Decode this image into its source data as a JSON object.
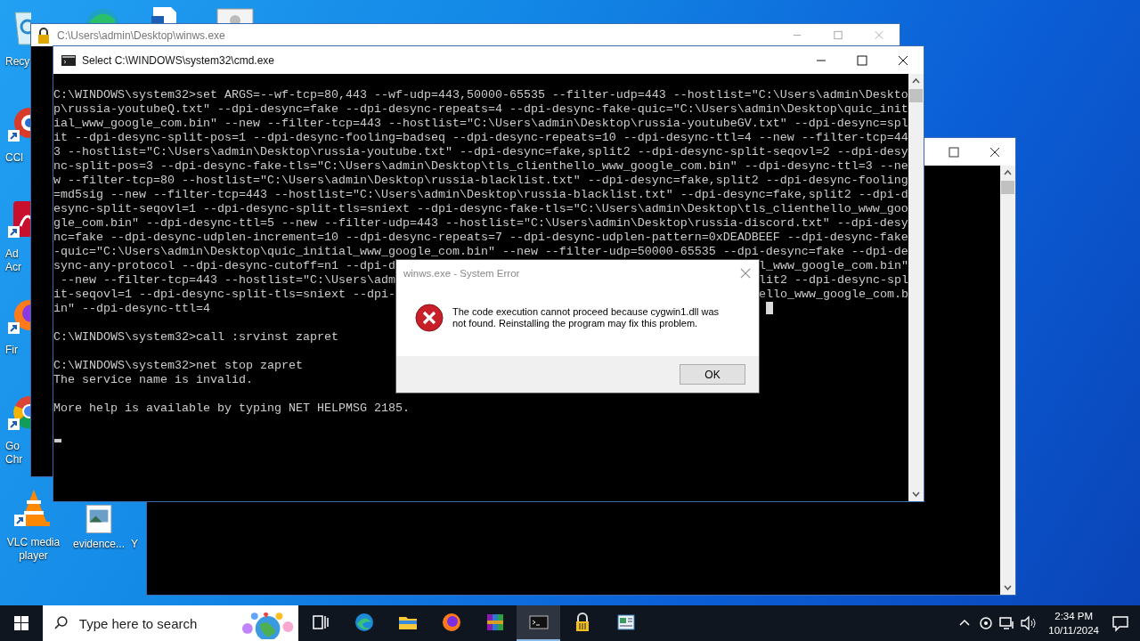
{
  "desktop_icons": [
    {
      "kind": "recycle-bin",
      "lines": [
        "Recy"
      ],
      "shortcut": false
    },
    {
      "kind": "ccleaner",
      "lines": [
        "CCl"
      ],
      "shortcut": true
    },
    {
      "kind": "acrobat",
      "lines": [
        "Ad",
        "Acr"
      ],
      "shortcut": true
    },
    {
      "kind": "firefox",
      "lines": [
        "Fir"
      ],
      "shortcut": true
    },
    {
      "kind": "chrome",
      "lines": [
        "Go",
        "Chr"
      ],
      "shortcut": true
    },
    {
      "kind": "vlc",
      "lines": [
        "VLC media",
        "player"
      ],
      "shortcut": true
    }
  ],
  "desktop_icons_2": [
    {
      "kind": "image",
      "lines": [
        "evidence..."
      ]
    },
    {
      "kind": "none",
      "lines": [
        "Y"
      ]
    }
  ],
  "winws_window": {
    "title": "C:\\Users\\admin\\Desktop\\winws.exe"
  },
  "cmd_window": {
    "title": "Select C:\\WINDOWS\\system32\\cmd.exe",
    "lines": [
      {
        "kind": "line",
        "text": "C:\\WINDOWS\\system32>set ARGS=--wf-tcp=80,443 --wf-udp=443,50000-65535 --filter-udp=443 --hostlist=\"C:\\Users\\admin\\Deskto"
      },
      {
        "kind": "line",
        "text": "p\\russia-youtubeQ.txt\" --dpi-desync=fake --dpi-desync-repeats=4 --dpi-desync-fake-quic=\"C:\\Users\\admin\\Desktop\\quic_init"
      },
      {
        "kind": "line",
        "text": "ial_www_google_com.bin\" --new --filter-tcp=443 --hostlist=\"C:\\Users\\admin\\Desktop\\russia-youtubeGV.txt\" --dpi-desync=spl"
      },
      {
        "kind": "line",
        "text": "it --dpi-desync-split-pos=1 --dpi-desync-fooling=badseq --dpi-desync-repeats=10 --dpi-desync-ttl=4 --new --filter-tcp=44"
      },
      {
        "kind": "line",
        "text": "3 --hostlist=\"C:\\Users\\admin\\Desktop\\russia-youtube.txt\" --dpi-desync=fake,split2 --dpi-desync-split-seqovl=2 --dpi-desy"
      },
      {
        "kind": "line",
        "text": "nc-split-pos=3 --dpi-desync-fake-tls=\"C:\\Users\\admin\\Desktop\\tls_clienthello_www_google_com.bin\" --dpi-desync-ttl=3 --ne"
      },
      {
        "kind": "line",
        "text": "w --filter-tcp=80 --hostlist=\"C:\\Users\\admin\\Desktop\\russia-blacklist.txt\" --dpi-desync=fake,split2 --dpi-desync-fooling"
      },
      {
        "kind": "line",
        "text": "=md5sig --new --filter-tcp=443 --hostlist=\"C:\\Users\\admin\\Desktop\\russia-blacklist.txt\" --dpi-desync=fake,split2 --dpi-d"
      },
      {
        "kind": "line",
        "text": "esync-split-seqovl=1 --dpi-desync-split-tls=sniext --dpi-desync-fake-tls=\"C:\\Users\\admin\\Desktop\\tls_clienthello_www_goo"
      },
      {
        "kind": "line",
        "text": "gle_com.bin\" --dpi-desync-ttl=5 --new --filter-udp=443 --hostlist=\"C:\\Users\\admin\\Desktop\\russia-discord.txt\" --dpi-desy"
      },
      {
        "kind": "line",
        "text": "nc=fake --dpi-desync-udplen-increment=10 --dpi-desync-repeats=7 --dpi-desync-udplen-pattern=0xDEADBEEF --dpi-desync-fake"
      },
      {
        "kind": "line",
        "text": "-quic=\"C:\\Users\\admin\\Desktop\\quic_initial_www_google_com.bin\" --new --filter-udp=50000-65535 --dpi-desync=fake --dpi-de"
      },
      {
        "kind": "split",
        "left": "sync-any-protocol --dpi-desync-cutoff=n1 --dpi-d",
        "right": "l_www_google_com.bin\""
      },
      {
        "kind": "split",
        "left": " --new --filter-tcp=443 --hostlist=\"C:\\Users\\adm",
        "right": "lit2 --dpi-desync-spl"
      },
      {
        "kind": "split",
        "left": "it-seqovl=1 --dpi-desync-split-tls=sniext --dpi-",
        "right": "ello_www_google_com.b"
      },
      {
        "kind": "line",
        "text": "in\" --dpi-desync-ttl=4"
      },
      {
        "kind": "blank"
      },
      {
        "kind": "line",
        "text": "C:\\WINDOWS\\system32>call :srvinst zapret"
      },
      {
        "kind": "blank"
      },
      {
        "kind": "line",
        "text": "C:\\WINDOWS\\system32>net stop zapret"
      },
      {
        "kind": "line",
        "text": "The service name is invalid."
      },
      {
        "kind": "blank"
      },
      {
        "kind": "line",
        "text": "More help is available by typing NET HELPMSG 2185."
      }
    ]
  },
  "dialog": {
    "title": "winws.exe - System Error",
    "message": "The code execution cannot proceed because cygwin1.dll was not found. Reinstalling the program may fix this problem.",
    "buttons": [
      "OK"
    ]
  },
  "taskbar": {
    "search": {
      "placeholder": "Type here to search"
    },
    "apps": [
      {
        "kind": "task-view",
        "selected": false
      },
      {
        "kind": "edge",
        "selected": false
      },
      {
        "kind": "explorer",
        "selected": false
      },
      {
        "kind": "firefox",
        "selected": false
      },
      {
        "kind": "winrar",
        "selected": false
      },
      {
        "kind": "cmd",
        "selected": true
      },
      {
        "kind": "lock",
        "selected": false
      },
      {
        "kind": "app",
        "selected": false
      }
    ],
    "time": "2:34 PM",
    "date": "10/11/2024"
  }
}
